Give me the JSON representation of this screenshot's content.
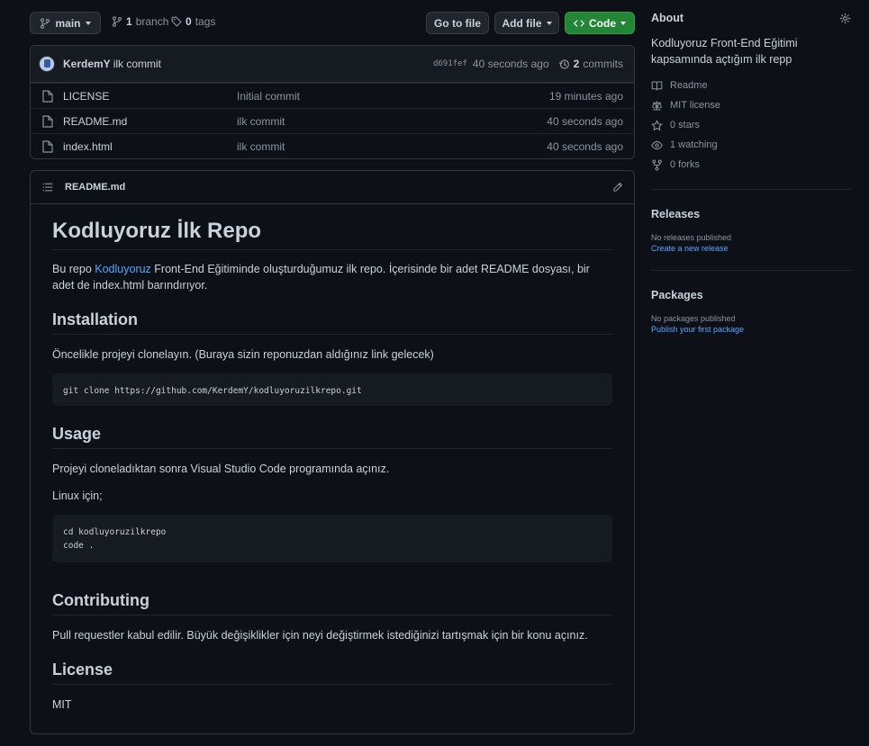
{
  "toolbar": {
    "branch": "main",
    "branch_count": "1",
    "branch_label": "branch",
    "tag_count": "0",
    "tag_label": "tags",
    "go_to_file": "Go to file",
    "add_file": "Add file",
    "code": "Code"
  },
  "commit": {
    "author": "KerdemY",
    "message": "ilk commit",
    "sha": "d691fef",
    "time": "40 seconds ago",
    "count": "2",
    "count_label": "commits"
  },
  "files": [
    {
      "name": "LICENSE",
      "commit": "Initial commit",
      "age": "19 minutes ago"
    },
    {
      "name": "README.md",
      "commit": "ilk commit",
      "age": "40 seconds ago"
    },
    {
      "name": "index.html",
      "commit": "ilk commit",
      "age": "40 seconds ago"
    }
  ],
  "readme": {
    "filename": "README.md",
    "title": "Kodluyoruz İlk Repo",
    "intro_before": "Bu repo ",
    "intro_link": "Kodluyoruz",
    "intro_after": " Front-End Eğitiminde oluşturduğumuz ilk repo. İçerisinde bir adet README dosyası, bir adet de index.html barındırıyor.",
    "installation_heading": "Installation",
    "installation_text": "Öncelikle projeyi clonelayın. (Buraya sizin reponuzdan aldığınız link gelecek)",
    "installation_code": "git clone https://github.com/KerdemY/kodluyoruzilkrepo.git",
    "usage_heading": "Usage",
    "usage_text": "Projeyi cloneladıktan sonra Visual Studio Code programında açınız.",
    "usage_linux": "Linux için;",
    "usage_code": "cd kodluyoruzilkrepo\ncode .",
    "contributing_heading": "Contributing",
    "contributing_text": "Pull requestler kabul edilir. Büyük değişiklikler için neyi değiştirmek istediğinizi tartışmak için bir konu açınız.",
    "license_heading": "License",
    "license_link": "MIT"
  },
  "about": {
    "heading": "About",
    "description": "Kodluyoruz Front-End Eğitimi kapsamında açtığım ilk repp",
    "items": [
      {
        "icon": "book-icon",
        "label": "Readme"
      },
      {
        "icon": "law-icon",
        "label": "MIT license"
      },
      {
        "icon": "star-icon",
        "label": "0 stars"
      },
      {
        "icon": "eye-icon",
        "label": "1 watching"
      },
      {
        "icon": "fork-icon",
        "label": "0 forks"
      }
    ]
  },
  "releases": {
    "heading": "Releases",
    "empty": "No releases published",
    "create": "Create a new release"
  },
  "packages": {
    "heading": "Packages",
    "empty": "No packages published",
    "publish": "Publish your first package"
  },
  "colors": {
    "background": "#0d1117",
    "link": "#58a6ff",
    "green_button": "#238636",
    "border": "#30363d"
  }
}
